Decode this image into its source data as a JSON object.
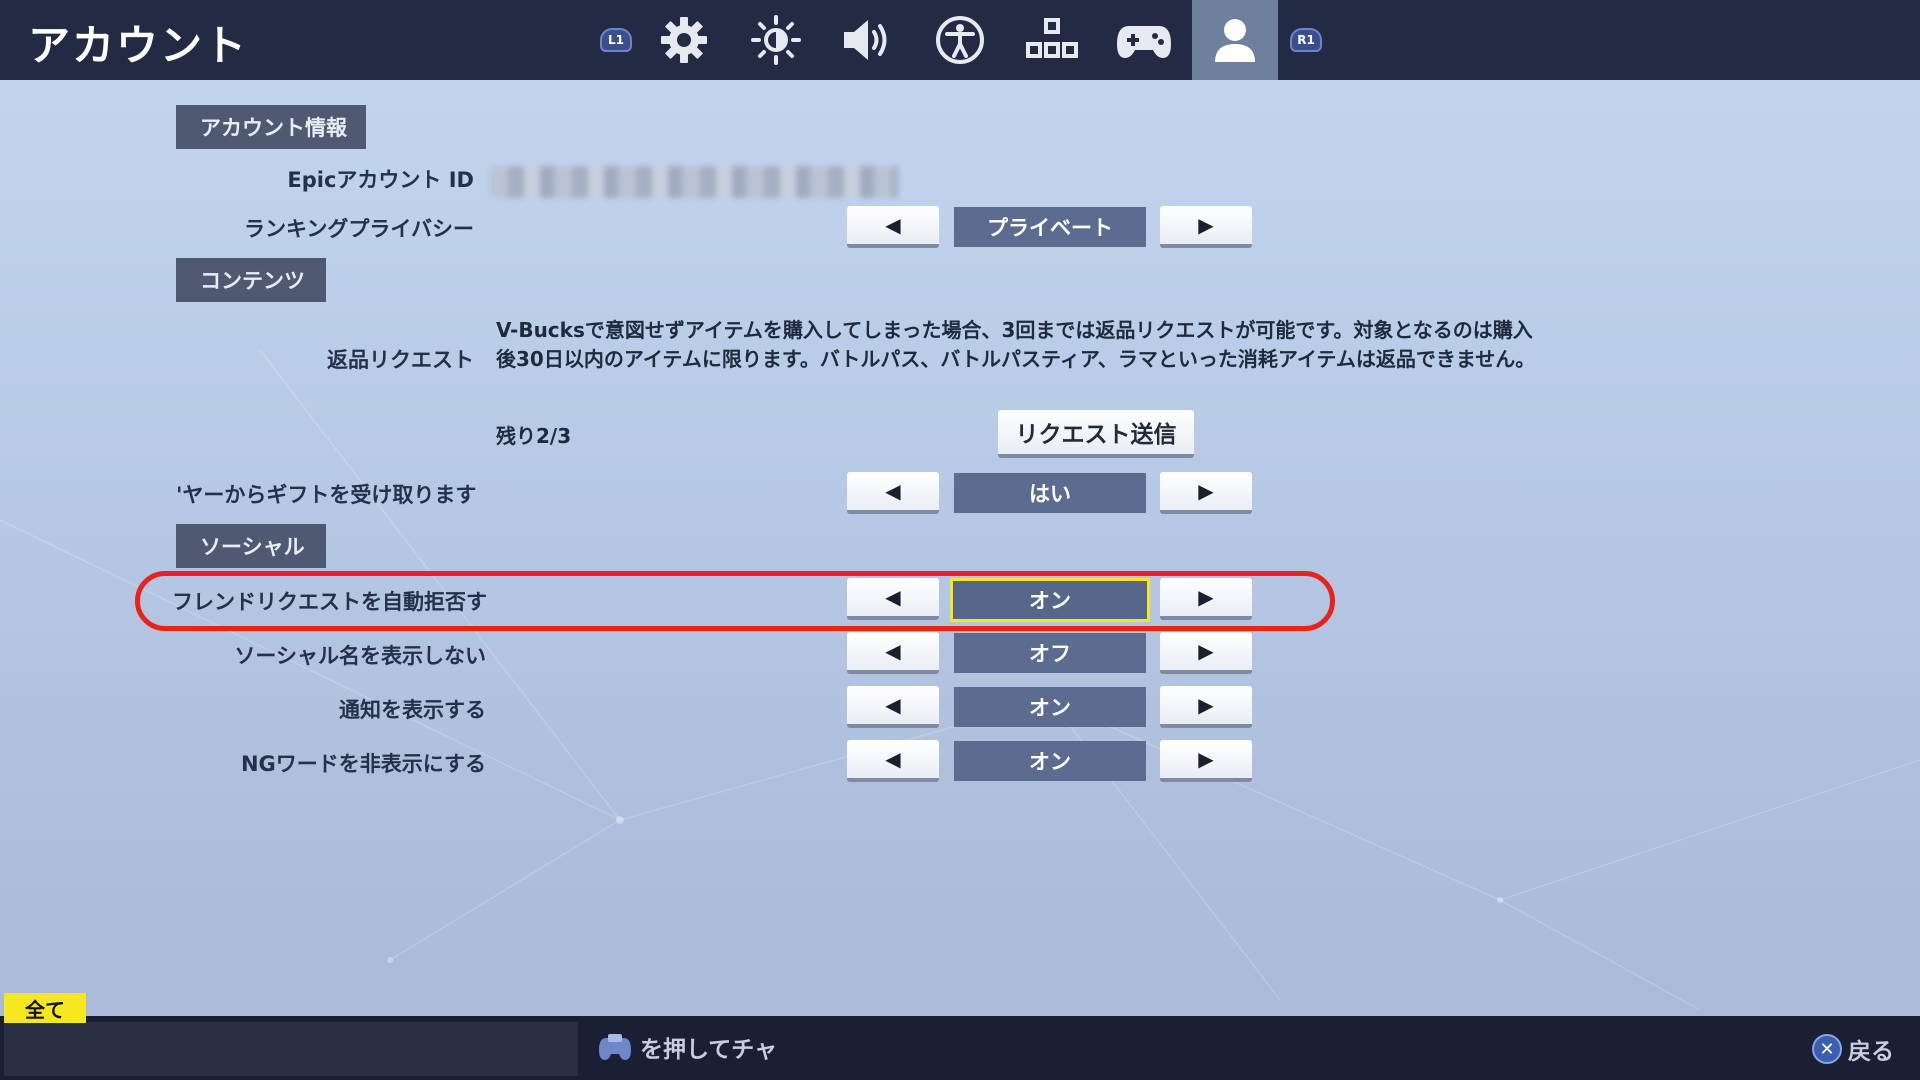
{
  "header": {
    "title": "アカウント",
    "tabs": [
      {
        "icon": "l1-bumper",
        "label": "L1"
      },
      {
        "icon": "gear-icon"
      },
      {
        "icon": "brightness-icon"
      },
      {
        "icon": "speaker-icon"
      },
      {
        "icon": "accessibility-icon"
      },
      {
        "icon": "input-layout-icon"
      },
      {
        "icon": "gamepad-icon"
      },
      {
        "icon": "person-icon",
        "active": true
      },
      {
        "icon": "r1-bumper",
        "label": "R1"
      }
    ]
  },
  "sections": {
    "account_info": "アカウント情報",
    "content": "コンテンツ",
    "social": "ソーシャル"
  },
  "account": {
    "epic_id_label": "Epicアカウント ID",
    "ranking_privacy_label": "ランキングプライバシー",
    "ranking_privacy_value": "プライベート"
  },
  "content": {
    "refund_label": "返品リクエスト",
    "refund_description": "V-Bucksで意図せずアイテムを購入してしまった場合、3回までは返品リクエストが可能です。対象となるのは購入後30日以内のアイテムに限ります。バトルパス、バトルパスティア、ラマといった消耗アイテムは返品できません。",
    "remaining": "残り2/3",
    "request_button": "リクエスト送信",
    "gift_label": "'ヤーからギフトを受け取ります",
    "gift_value": "はい"
  },
  "social": {
    "auto_decline_label": "フレンドリクエストを自動拒否す",
    "auto_decline_value": "オン",
    "hide_name_label": "ソーシャル名を表示しない",
    "hide_name_value": "オフ",
    "notify_label": "通知を表示する",
    "notify_value": "オン",
    "ng_word_label": "NGワードを非表示にする",
    "ng_word_value": "オン"
  },
  "arrows": {
    "left": "◀",
    "right": "▶"
  },
  "footer": {
    "chat_filter": "全て",
    "chat_hint": "を押してチャ",
    "back_label": "戻る",
    "back_glyph": "✕"
  },
  "colors": {
    "highlight": "#e8221c",
    "focus": "#f5e628",
    "topbar": "#222a44"
  }
}
